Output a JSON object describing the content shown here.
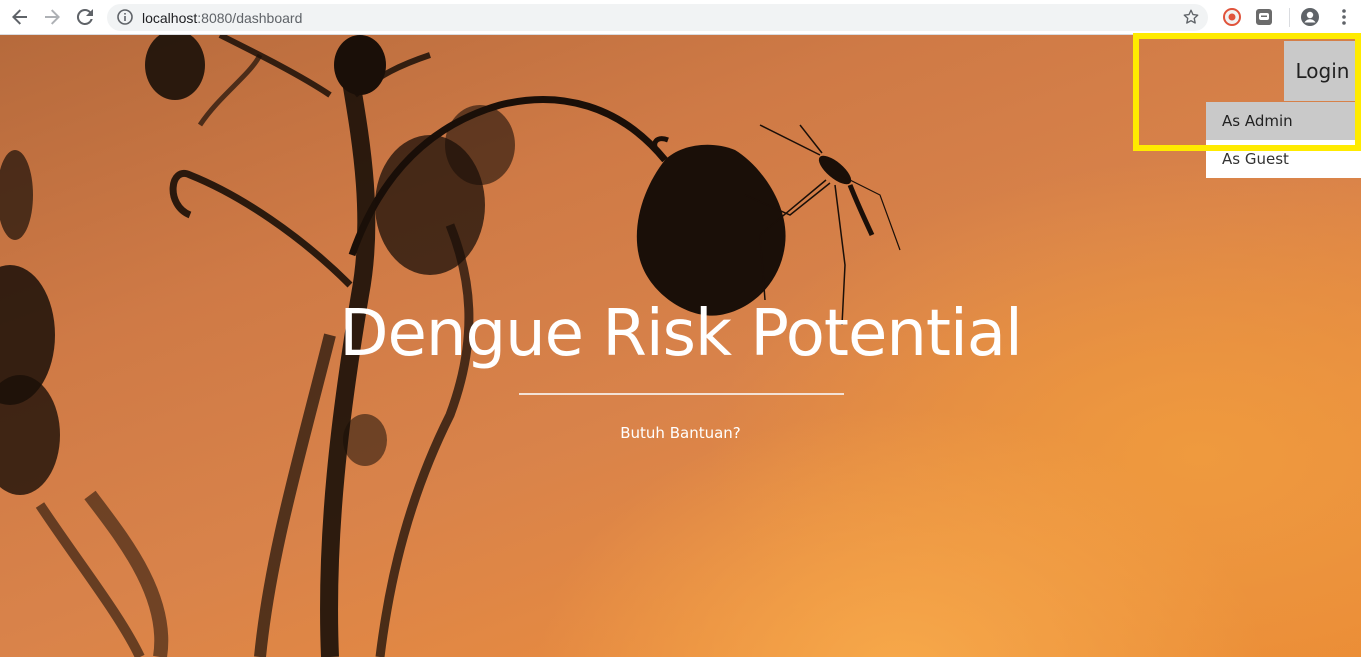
{
  "browser": {
    "url_host": "localhost",
    "url_rest": ":8080/dashboard"
  },
  "hero": {
    "title": "Dengue Risk Potential",
    "help_link": "Butuh Bantuan?"
  },
  "login": {
    "label": "Login",
    "options": [
      "As Admin",
      "As Guest"
    ],
    "active_option": "As Admin"
  },
  "colors": {
    "highlight": "#ffeb00",
    "menu_active": "#c9c9c9",
    "hero_orange": "#e88b3f"
  }
}
